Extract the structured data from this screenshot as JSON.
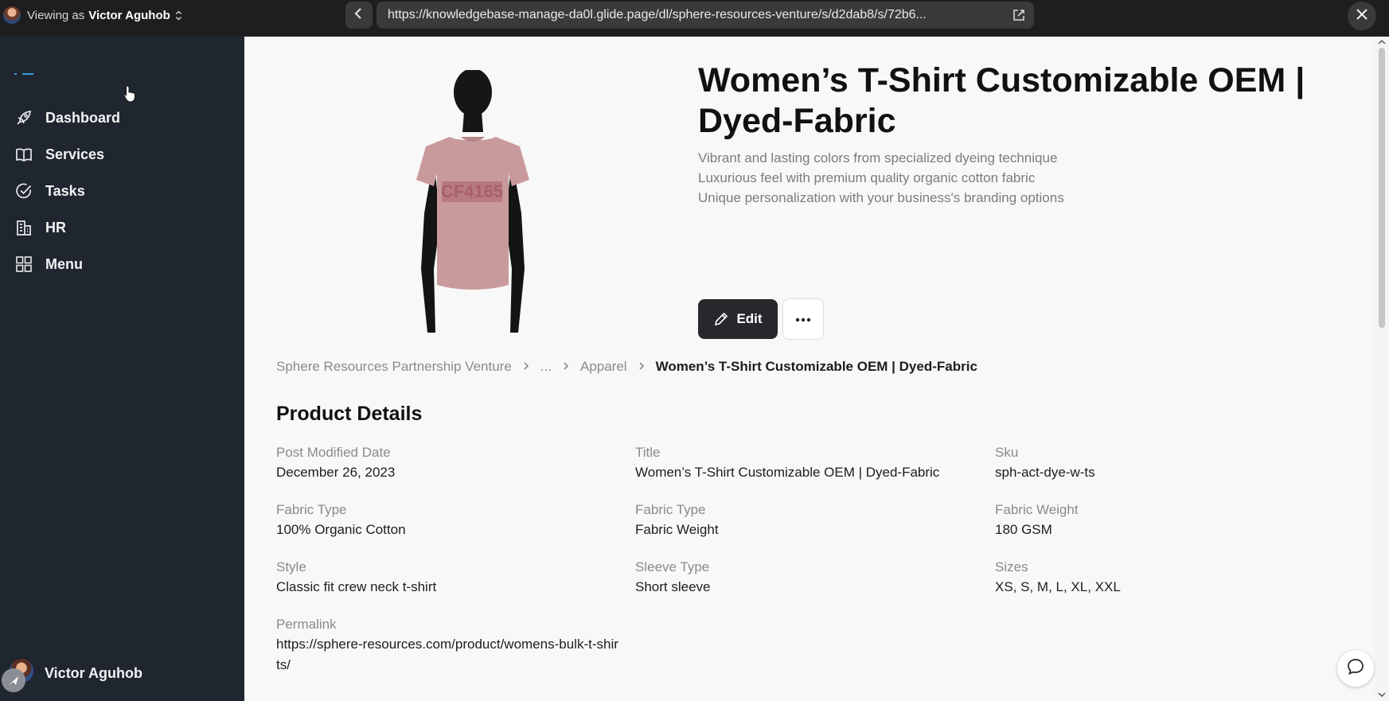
{
  "topbar": {
    "viewing_prefix": "Viewing as",
    "viewing_user": "Victor Aguhob",
    "url": "https://knowledgebase-manage-da0l.glide.page/dl/sphere-resources-venture/s/d2dab8/s/72b6..."
  },
  "sidebar": {
    "items": [
      {
        "label": "Dashboard",
        "icon": "rocket-icon"
      },
      {
        "label": "Services",
        "icon": "book-icon"
      },
      {
        "label": "Tasks",
        "icon": "check-circle-icon"
      },
      {
        "label": "HR",
        "icon": "building-icon"
      },
      {
        "label": "Menu",
        "icon": "grid-icon"
      }
    ],
    "user_name": "Victor Aguhob"
  },
  "product": {
    "title": "Women’s T-Shirt Customizable OEM | Dyed-Fabric",
    "features": [
      "Vibrant and lasting colors from specialized dyeing technique",
      "Luxurious feel with premium quality organic cotton fabric",
      "Unique personalization with your business's branding options"
    ],
    "shirt_print": "CF4165",
    "edit_label": "Edit"
  },
  "breadcrumb": {
    "items": [
      "Sphere Resources Partnership Venture",
      "...",
      "Apparel"
    ],
    "current": "Women’s T-Shirt Customizable OEM | Dyed-Fabric"
  },
  "details": {
    "section_title": "Product Details",
    "fields": [
      {
        "label": "Post Modified Date",
        "value": "December 26, 2023"
      },
      {
        "label": "Title",
        "value": "Women’s T-Shirt Customizable OEM | Dyed-Fabric"
      },
      {
        "label": "Sku",
        "value": "sph-act-dye-w-ts"
      },
      {
        "label": "Fabric Type",
        "value": "100% Organic Cotton"
      },
      {
        "label": "Fabric Type",
        "value": "Fabric Weight"
      },
      {
        "label": "Fabric Weight",
        "value": "180 GSM"
      },
      {
        "label": "Style",
        "value": "Classic fit crew neck t-shirt"
      },
      {
        "label": "Sleeve Type",
        "value": "Short sleeve"
      },
      {
        "label": "Sizes",
        "value": "XS, S, M, L, XL, XXL"
      },
      {
        "label": "Permalink",
        "value": "https://sphere-resources.com/product/womens-bulk-t-shirts/"
      }
    ]
  },
  "colors": {
    "sidebar_bg": "#20262f",
    "topbar_bg": "#1e1e20",
    "primary_button": "#26282c",
    "shirt": "#c99a9c"
  }
}
